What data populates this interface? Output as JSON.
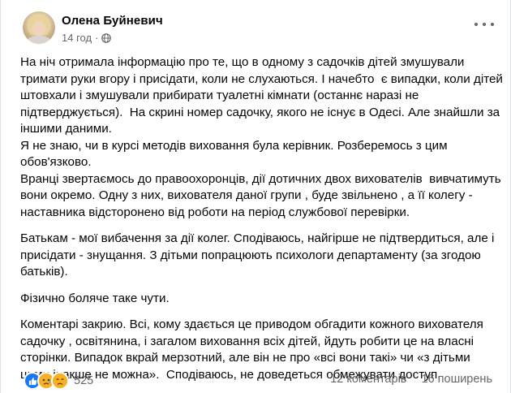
{
  "post": {
    "author": "Олена Буйневич",
    "time": "14 год",
    "separator": "·",
    "privacy_icon": "globe-icon",
    "menu_icon": "more-options-icon",
    "paragraphs": [
      [
        "На ніч отримала інформацію про те, що в одному з садочків дітей змушували",
        "тримати руки вгору і присідати, коли не слухаються. І начебто  є випадки, коли дітей",
        "штовхали і змушували прибирати туалетні кімнати (останнє наразі не",
        "підтверджується).  На скрині номер садочку, якого не існує в Одесі. Але знайшли за",
        "іншими даними.",
        "Я не знаю, чи в курсі методів виховання була керівник. Розберемось з цим",
        "обов'язково.",
        "Вранці звертаємось до правоохоронців, дії дотичних двох вихователів  вивчатимуть",
        "вони окремо. Одну з них, вихователя даної групи , буде звільнено , а її колегу -",
        "наставника відсторонено від роботи на період службової перевірки."
      ],
      [
        "Батькам - мої вибачення за дії колег. Сподіваюсь, найгірше не підтвердиться, але і",
        "присідати - знущання. З дітьми попрацюють психологи департаменту (за згодою",
        "батьків)."
      ],
      [
        "Фізично боляче таке чути."
      ],
      [
        "Коментарі закрию. Всі, кому здається це приводом обгадити кожного вихователя",
        "садочку , освітянина, і загалом виховання всіх дітей, йдуть робити це на власні",
        "сторінки. Випадок вкрай мерзотний, але він не про «всі вони такі» чи «з дітьми",
        "цими інакше не можна».  Сподіваюсь, не доведеться обмежувати доступ."
      ]
    ]
  },
  "footer": {
    "reaction_icons": [
      "like-icon",
      "sad-icon",
      "sad-icon"
    ],
    "reaction_count": "525",
    "comments": "12 коментарів",
    "shares": "16 поширень"
  },
  "colors": {
    "primary_text": "#050505",
    "secondary_text": "#65676b",
    "like_blue": "#1877f2",
    "emoji_yellow": "#f7b125"
  }
}
